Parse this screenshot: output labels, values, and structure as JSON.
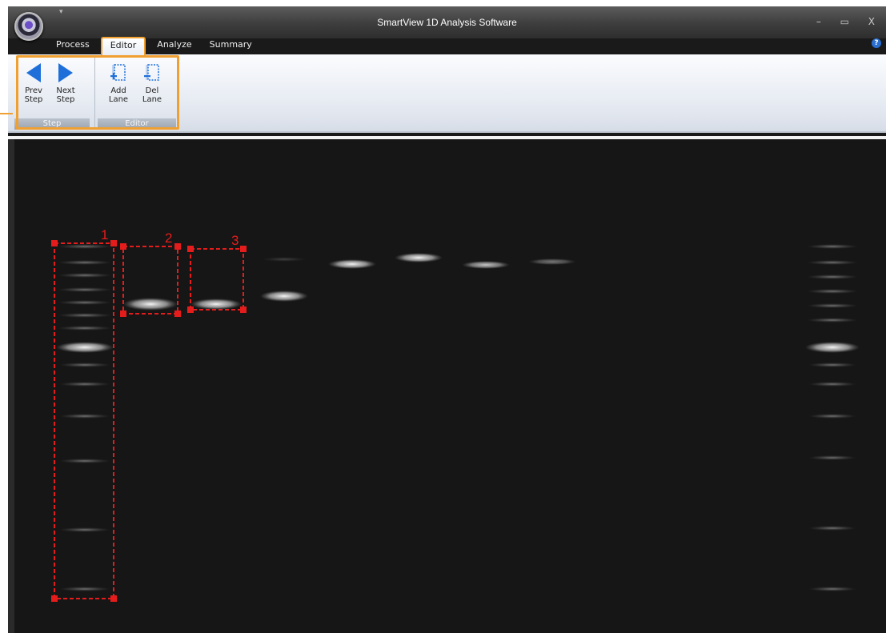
{
  "window": {
    "title": "SmartView 1D Analysis Software",
    "controls": "– ▭ X",
    "help": "?"
  },
  "tabs": [
    {
      "label": "Process"
    },
    {
      "label": "Editor",
      "active": true
    },
    {
      "label": "Analyze"
    },
    {
      "label": "Summary"
    }
  ],
  "ribbon": {
    "groups": [
      {
        "label": "Step",
        "buttons": [
          {
            "line1": "Prev",
            "line2": "Step",
            "icon": "arrow-left-icon"
          },
          {
            "line1": "Next",
            "line2": "Step",
            "icon": "arrow-right-icon"
          }
        ]
      },
      {
        "label": "Editor",
        "buttons": [
          {
            "line1": "Add",
            "line2": "Lane",
            "icon": "add-lane-icon"
          },
          {
            "line1": "Del",
            "line2": "Lane",
            "icon": "del-lane-icon"
          }
        ]
      }
    ]
  },
  "lanes": [
    {
      "number": "1"
    },
    {
      "number": "2"
    },
    {
      "number": "3"
    }
  ],
  "colors": {
    "accent": "#f0a030",
    "lane_marker": "#e51c1c",
    "icon_blue": "#1e6fd9"
  }
}
